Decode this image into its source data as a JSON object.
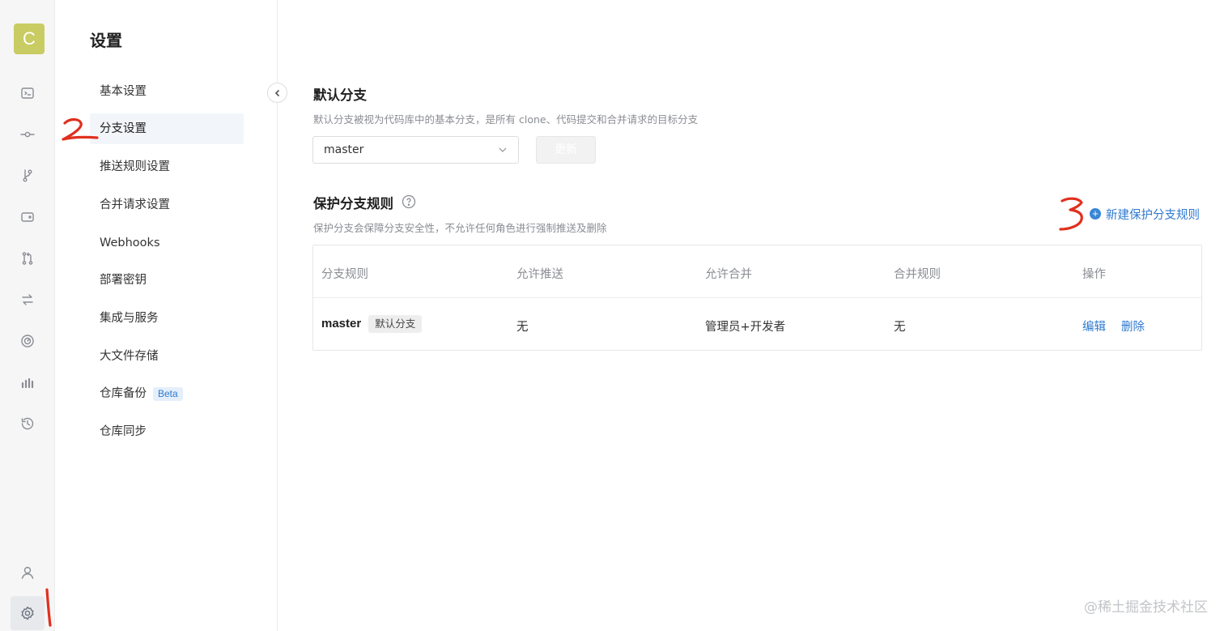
{
  "avatar": {
    "letter": "C",
    "color": "#c9cc62"
  },
  "rail": {
    "items": [
      {
        "name": "code-icon"
      },
      {
        "name": "commit-icon"
      },
      {
        "name": "branch-icon"
      },
      {
        "name": "tag-icon"
      },
      {
        "name": "merge-request-icon"
      },
      {
        "name": "sync-icon"
      },
      {
        "name": "pipeline-icon"
      },
      {
        "name": "stats-icon"
      },
      {
        "name": "history-icon"
      }
    ],
    "bottom": [
      {
        "name": "user-icon"
      },
      {
        "name": "gear-icon",
        "active": true
      }
    ]
  },
  "settings": {
    "title": "设置",
    "items": [
      {
        "label": "基本设置"
      },
      {
        "label": "分支设置",
        "active": true
      },
      {
        "label": "推送规则设置"
      },
      {
        "label": "合并请求设置"
      },
      {
        "label": "Webhooks"
      },
      {
        "label": "部署密钥"
      },
      {
        "label": "集成与服务"
      },
      {
        "label": "大文件存储"
      },
      {
        "label": "仓库备份",
        "badge": "Beta"
      },
      {
        "label": "仓库同步"
      }
    ]
  },
  "default_branch": {
    "title": "默认分支",
    "description": "默认分支被视为代码库中的基本分支，是所有 clone、代码提交和合并请求的目标分支",
    "selected": "master",
    "update_label": "更新"
  },
  "protected_rules": {
    "title": "保护分支规则",
    "description": "保护分支会保障分支安全性，不允许任何角色进行强制推送及删除",
    "new_label": "新建保护分支规则",
    "columns": [
      "分支规则",
      "允许推送",
      "允许合并",
      "合并规则",
      "操作"
    ],
    "rows": [
      {
        "branch": "master",
        "tag": "默认分支",
        "allow_push": "无",
        "allow_merge": "管理员+开发者",
        "merge_rule": "无",
        "actions": [
          "编辑",
          "删除"
        ]
      }
    ]
  },
  "annotations": [
    "1",
    "2",
    "3"
  ],
  "watermark": "@稀土掘金技术社区",
  "colors": {
    "accent": "#2f7ad0",
    "annotation": "#e0301e"
  }
}
